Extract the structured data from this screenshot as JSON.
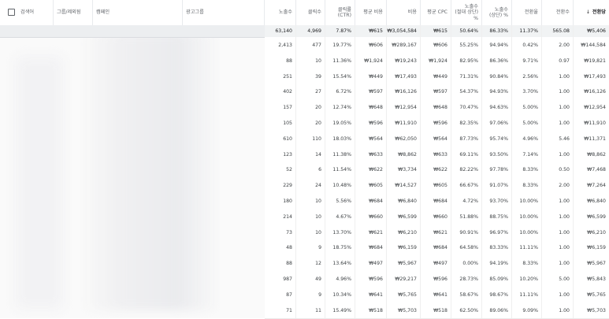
{
  "header": {
    "keyword": "검색어",
    "adgroup_partial": "그룹/제외됨",
    "campaign": "캠페인",
    "adgroup": "광고그룹",
    "impressions": "노출수",
    "clicks": "클릭수",
    "ctr": "클릭률\n(CTR)",
    "avg_cost": "평균 비용",
    "cost": "비용",
    "avg_cpc": "평균 CPC",
    "impr_top_abs": "노출수\n(절대 상단)\n%",
    "impr_top": "노출수\n(상단) %",
    "conv_rate": "전환율",
    "conversions": "전환수",
    "cost_per_conv": "전환당",
    "sort_arrow": "↓"
  },
  "totals": [
    "63,140",
    "4,969",
    "7.87%",
    "₩615",
    "₩3,054,584",
    "₩615",
    "50.64%",
    "86.33%",
    "11.37%",
    "565.08",
    "₩5,406"
  ],
  "rows": [
    [
      "2,413",
      "477",
      "19.77%",
      "₩606",
      "₩289,167",
      "₩606",
      "55.25%",
      "94.94%",
      "0.42%",
      "2.00",
      "₩144,584"
    ],
    [
      "88",
      "10",
      "11.36%",
      "₩1,924",
      "₩19,243",
      "₩1,924",
      "82.95%",
      "86.36%",
      "9.71%",
      "0.97",
      "₩19,821"
    ],
    [
      "251",
      "39",
      "15.54%",
      "₩449",
      "₩17,493",
      "₩449",
      "71.31%",
      "90.84%",
      "2.56%",
      "1.00",
      "₩17,493"
    ],
    [
      "402",
      "27",
      "6.72%",
      "₩597",
      "₩16,126",
      "₩597",
      "54.37%",
      "94.93%",
      "3.70%",
      "1.00",
      "₩16,126"
    ],
    [
      "157",
      "20",
      "12.74%",
      "₩648",
      "₩12,954",
      "₩648",
      "70.47%",
      "94.63%",
      "5.00%",
      "1.00",
      "₩12,954"
    ],
    [
      "105",
      "20",
      "19.05%",
      "₩596",
      "₩11,910",
      "₩596",
      "82.35%",
      "97.06%",
      "5.00%",
      "1.00",
      "₩11,910"
    ],
    [
      "610",
      "110",
      "18.03%",
      "₩564",
      "₩62,050",
      "₩564",
      "87.73%",
      "95.74%",
      "4.96%",
      "5.46",
      "₩11,371"
    ],
    [
      "123",
      "14",
      "11.38%",
      "₩633",
      "₩8,862",
      "₩633",
      "69.11%",
      "93.50%",
      "7.14%",
      "1.00",
      "₩8,862"
    ],
    [
      "52",
      "6",
      "11.54%",
      "₩622",
      "₩3,734",
      "₩622",
      "82.22%",
      "97.78%",
      "8.33%",
      "0.50",
      "₩7,468"
    ],
    [
      "229",
      "24",
      "10.48%",
      "₩605",
      "₩14,527",
      "₩605",
      "66.67%",
      "91.07%",
      "8.33%",
      "2.00",
      "₩7,264"
    ],
    [
      "180",
      "10",
      "5.56%",
      "₩684",
      "₩6,840",
      "₩684",
      "4.72%",
      "93.70%",
      "10.00%",
      "1.00",
      "₩6,840"
    ],
    [
      "214",
      "10",
      "4.67%",
      "₩660",
      "₩6,599",
      "₩660",
      "51.88%",
      "88.75%",
      "10.00%",
      "1.00",
      "₩6,599"
    ],
    [
      "73",
      "10",
      "13.70%",
      "₩621",
      "₩6,210",
      "₩621",
      "90.91%",
      "96.97%",
      "10.00%",
      "1.00",
      "₩6,210"
    ],
    [
      "48",
      "9",
      "18.75%",
      "₩684",
      "₩6,159",
      "₩684",
      "64.58%",
      "83.33%",
      "11.11%",
      "1.00",
      "₩6,159"
    ],
    [
      "88",
      "12",
      "13.64%",
      "₩497",
      "₩5,967",
      "₩497",
      "0.00%",
      "94.19%",
      "8.33%",
      "1.00",
      "₩5,967"
    ],
    [
      "987",
      "49",
      "4.96%",
      "₩596",
      "₩29,217",
      "₩596",
      "28.73%",
      "85.09%",
      "10.20%",
      "5.00",
      "₩5,843"
    ],
    [
      "87",
      "9",
      "10.34%",
      "₩641",
      "₩5,765",
      "₩641",
      "58.67%",
      "98.67%",
      "11.11%",
      "1.00",
      "₩5,765"
    ],
    [
      "71",
      "11",
      "15.49%",
      "₩518",
      "₩5,703",
      "₩518",
      "62.50%",
      "89.06%",
      "9.09%",
      "1.00",
      "₩5,703"
    ]
  ]
}
